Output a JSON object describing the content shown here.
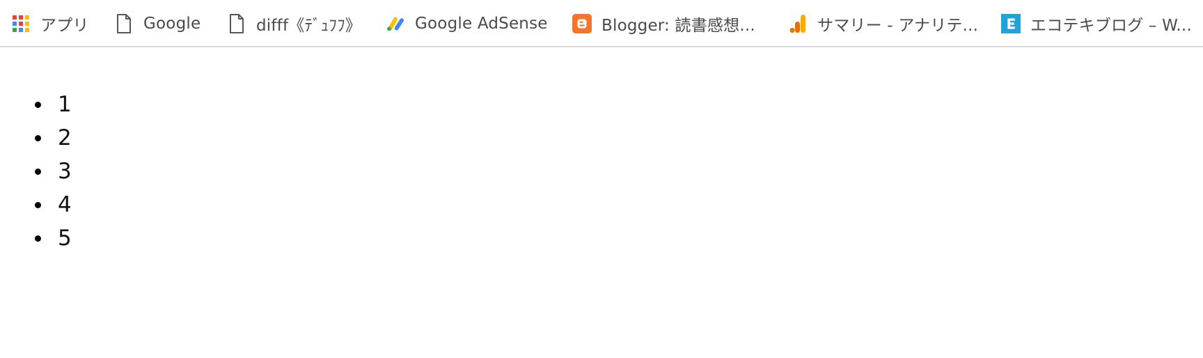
{
  "bookmarks": [
    {
      "label": "アプリ",
      "icon": "apps-grid-icon"
    },
    {
      "label": "Google",
      "icon": "page-icon"
    },
    {
      "label": "difff《ﾃﾞｭﾌﾌ》",
      "icon": "page-icon"
    },
    {
      "label": "Google AdSense",
      "icon": "adsense-icon"
    },
    {
      "label": "Blogger: 読書感想...",
      "icon": "blogger-icon"
    },
    {
      "label": "サマリー - アナリテ...",
      "icon": "analytics-icon"
    },
    {
      "label": "エコテキブログ – W...",
      "icon": "ecoteki-e-icon"
    }
  ],
  "list_items": [
    "1",
    "2",
    "3",
    "4",
    "5"
  ],
  "colors": {
    "blogger": "#f4752b",
    "analytics_orange": "#f9ab00",
    "analytics_dark": "#e37400",
    "ecoteki_blue": "#21a3d9",
    "adsense_blue": "#4285f4",
    "adsense_yellow": "#fbbc04",
    "adsense_green": "#34a853"
  }
}
